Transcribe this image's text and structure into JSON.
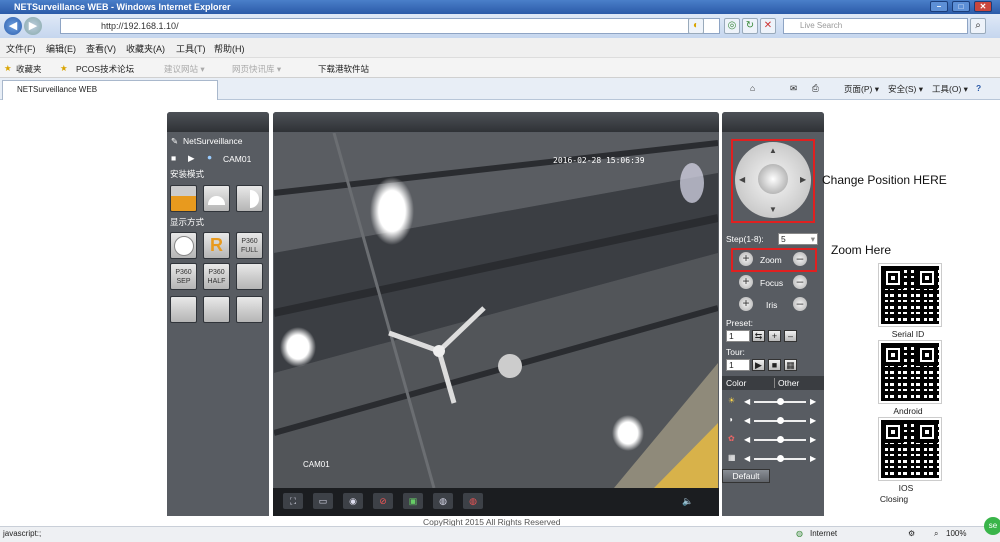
{
  "window": {
    "title": "NETSurveillance WEB - Windows Internet Explorer"
  },
  "nav": {
    "url": "http://192.168.1.10/",
    "search_placeholder": "Live Search"
  },
  "menu": [
    "文件(F)",
    "编辑(E)",
    "查看(V)",
    "收藏夹(A)",
    "工具(T)",
    "帮助(H)"
  ],
  "favorites": {
    "label": "收藏夹",
    "items": [
      "PCOS技术论坛",
      "建议网站 ▾",
      "网页快讯库 ▾",
      "下载港软件站"
    ]
  },
  "tab": {
    "title": "NETSurveillance WEB"
  },
  "cmdbar": {
    "page": "页面(P) ▾",
    "safety": "安全(S) ▾",
    "tools": "工具(O) ▾",
    "help": "?"
  },
  "left": {
    "brand": "NetSurveillance",
    "cam": "CAM01",
    "install_mode": "安装模式",
    "display_mode": "显示方式",
    "buttons": [
      "P360 FULL",
      "P360 SEP",
      "P360 HALF"
    ],
    "r_label": "R"
  },
  "video": {
    "timestamp": "2016-02-28 15:06:39",
    "cam_label": "CAM01",
    "copyright": "CopyRight 2015 All Rights Reserved"
  },
  "right": {
    "step_label": "Step(1-8):",
    "step_value": "5",
    "zoom": "Zoom",
    "focus": "Focus",
    "iris": "Iris",
    "preset": "Preset:",
    "preset_value": "1",
    "tour": "Tour:",
    "tour_value": "1",
    "tab_color": "Color",
    "tab_other": "Other",
    "default": "Default",
    "color_levels": [
      0.5,
      0.5,
      0.5,
      0.5
    ]
  },
  "annotations": {
    "position": "Change Position HERE",
    "zoom": "Zoom Here",
    "serial": "Serial ID",
    "android": "Android",
    "ios": "IOS",
    "closing": "Closing"
  },
  "status": {
    "left": "javascript:;",
    "zone": "Internet",
    "zoom": "100%"
  }
}
